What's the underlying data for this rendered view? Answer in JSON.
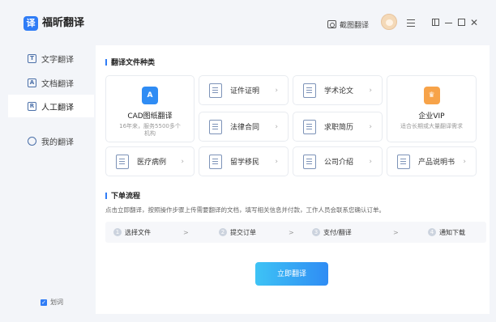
{
  "app": {
    "title": "福昕翻译",
    "logo_char": "译"
  },
  "toolbar": {
    "screenshot_label": "截图翻译"
  },
  "sidebar": {
    "items": [
      {
        "label": "文字翻译",
        "icon": "T"
      },
      {
        "label": "文档翻译",
        "icon": "A"
      },
      {
        "label": "人工翻译",
        "icon": "R"
      },
      {
        "label": "我的翻译",
        "icon": ""
      }
    ],
    "active": "人工翻译",
    "footer_label": "划词",
    "footer_checked": true
  },
  "section1": {
    "title": "翻译文件种类"
  },
  "cards": {
    "cad": {
      "title": "CAD图纸翻译",
      "subtitle": "16年来，服务5500多个机构",
      "icon_text": "A"
    },
    "vip": {
      "title": "企业VIP",
      "subtitle": "适合长期或大量翻译需求"
    },
    "items": [
      "证件证明",
      "学术论文",
      "法律合同",
      "求职简历",
      "医疗病例",
      "留学移民",
      "公司介绍",
      "产品说明书"
    ]
  },
  "section2": {
    "title": "下单流程",
    "description": "点击立即翻译，按照操作步骤上传需要翻译的文档，填写相关信息并付款，工作人员会联系您确认订单。",
    "steps": [
      {
        "num": "1",
        "label": "选择文件"
      },
      {
        "num": "2",
        "label": "提交订单"
      },
      {
        "num": "3",
        "label": "支付/翻译"
      },
      {
        "num": "4",
        "label": "通知下载"
      }
    ],
    "arrow": ">"
  },
  "cta": {
    "label": "立即翻译"
  },
  "colors": {
    "accent": "#2f7cf6",
    "vip": "#f7a349",
    "cad": "#2f8cf4"
  }
}
